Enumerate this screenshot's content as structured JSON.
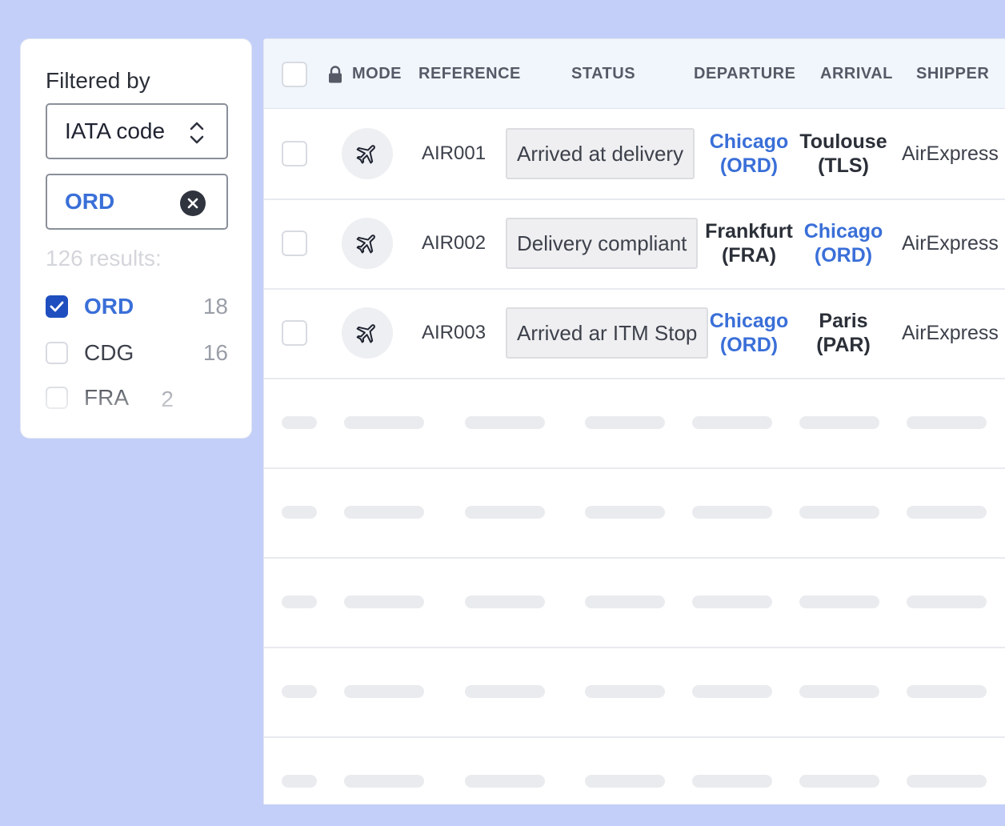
{
  "filter": {
    "title": "Filtered by",
    "select_value": "IATA code",
    "chip_value": "ORD",
    "results_text": "126 results:",
    "options": [
      {
        "label": "ORD",
        "count": "18",
        "checked": true
      },
      {
        "label": "CDG",
        "count": "16",
        "checked": false
      },
      {
        "label": "FRA",
        "count": "2",
        "checked": false
      }
    ]
  },
  "table": {
    "headers": {
      "mode": "MODE",
      "reference": "REFERENCE",
      "status": "STATUS",
      "departure": "DEPARTURE",
      "arrival": "ARRIVAL",
      "shipper": "SHIPPER"
    },
    "rows": [
      {
        "mode_icon": "plane-icon",
        "reference": "AIR001",
        "status": "Arrived at delivery",
        "departure_city": "Chicago",
        "departure_code": "(ORD)",
        "arrival_city": "Toulouse",
        "arrival_code": "(TLS)",
        "shipper": "AirExpress"
      },
      {
        "mode_icon": "plane-icon",
        "reference": "AIR002",
        "status": "Delivery compliant",
        "departure_city": "Frankfurt",
        "departure_code": "(FRA)",
        "arrival_city": "Chicago",
        "arrival_code": "(ORD)",
        "shipper": "AirExpress"
      },
      {
        "mode_icon": "plane-icon",
        "reference": "AIR003",
        "status": "Arrived ar ITM Stop",
        "departure_city": "Chicago",
        "departure_code": "(ORD)",
        "arrival_city": "Paris",
        "arrival_code": "(PAR)",
        "shipper": "AirExpress"
      }
    ]
  },
  "colors": {
    "background": "#c3cff8",
    "accent": "#3a6fd8",
    "checkbox_checked": "#1f4fbf",
    "header_bg": "#f1f6fd"
  }
}
